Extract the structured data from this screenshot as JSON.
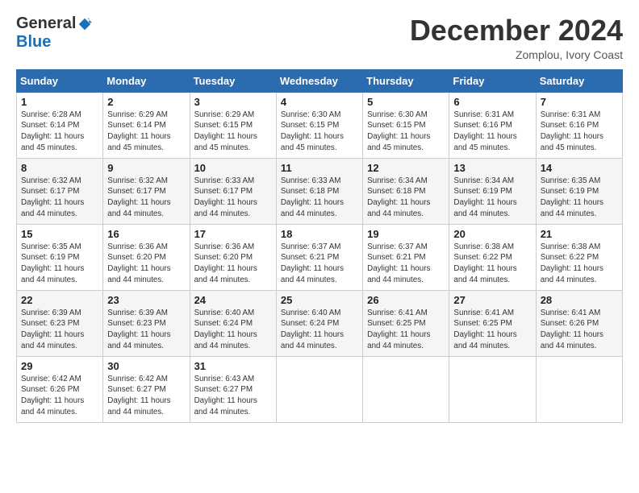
{
  "logo": {
    "general": "General",
    "blue": "Blue"
  },
  "header": {
    "month_title": "December 2024",
    "location": "Zomplou, Ivory Coast"
  },
  "days_of_week": [
    "Sunday",
    "Monday",
    "Tuesday",
    "Wednesday",
    "Thursday",
    "Friday",
    "Saturday"
  ],
  "weeks": [
    [
      {
        "day": "1",
        "sunrise": "6:28 AM",
        "sunset": "6:14 PM",
        "daylight": "11 hours and 45 minutes."
      },
      {
        "day": "2",
        "sunrise": "6:29 AM",
        "sunset": "6:14 PM",
        "daylight": "11 hours and 45 minutes."
      },
      {
        "day": "3",
        "sunrise": "6:29 AM",
        "sunset": "6:15 PM",
        "daylight": "11 hours and 45 minutes."
      },
      {
        "day": "4",
        "sunrise": "6:30 AM",
        "sunset": "6:15 PM",
        "daylight": "11 hours and 45 minutes."
      },
      {
        "day": "5",
        "sunrise": "6:30 AM",
        "sunset": "6:15 PM",
        "daylight": "11 hours and 45 minutes."
      },
      {
        "day": "6",
        "sunrise": "6:31 AM",
        "sunset": "6:16 PM",
        "daylight": "11 hours and 45 minutes."
      },
      {
        "day": "7",
        "sunrise": "6:31 AM",
        "sunset": "6:16 PM",
        "daylight": "11 hours and 45 minutes."
      }
    ],
    [
      {
        "day": "8",
        "sunrise": "6:32 AM",
        "sunset": "6:17 PM",
        "daylight": "11 hours and 44 minutes."
      },
      {
        "day": "9",
        "sunrise": "6:32 AM",
        "sunset": "6:17 PM",
        "daylight": "11 hours and 44 minutes."
      },
      {
        "day": "10",
        "sunrise": "6:33 AM",
        "sunset": "6:17 PM",
        "daylight": "11 hours and 44 minutes."
      },
      {
        "day": "11",
        "sunrise": "6:33 AM",
        "sunset": "6:18 PM",
        "daylight": "11 hours and 44 minutes."
      },
      {
        "day": "12",
        "sunrise": "6:34 AM",
        "sunset": "6:18 PM",
        "daylight": "11 hours and 44 minutes."
      },
      {
        "day": "13",
        "sunrise": "6:34 AM",
        "sunset": "6:19 PM",
        "daylight": "11 hours and 44 minutes."
      },
      {
        "day": "14",
        "sunrise": "6:35 AM",
        "sunset": "6:19 PM",
        "daylight": "11 hours and 44 minutes."
      }
    ],
    [
      {
        "day": "15",
        "sunrise": "6:35 AM",
        "sunset": "6:19 PM",
        "daylight": "11 hours and 44 minutes."
      },
      {
        "day": "16",
        "sunrise": "6:36 AM",
        "sunset": "6:20 PM",
        "daylight": "11 hours and 44 minutes."
      },
      {
        "day": "17",
        "sunrise": "6:36 AM",
        "sunset": "6:20 PM",
        "daylight": "11 hours and 44 minutes."
      },
      {
        "day": "18",
        "sunrise": "6:37 AM",
        "sunset": "6:21 PM",
        "daylight": "11 hours and 44 minutes."
      },
      {
        "day": "19",
        "sunrise": "6:37 AM",
        "sunset": "6:21 PM",
        "daylight": "11 hours and 44 minutes."
      },
      {
        "day": "20",
        "sunrise": "6:38 AM",
        "sunset": "6:22 PM",
        "daylight": "11 hours and 44 minutes."
      },
      {
        "day": "21",
        "sunrise": "6:38 AM",
        "sunset": "6:22 PM",
        "daylight": "11 hours and 44 minutes."
      }
    ],
    [
      {
        "day": "22",
        "sunrise": "6:39 AM",
        "sunset": "6:23 PM",
        "daylight": "11 hours and 44 minutes."
      },
      {
        "day": "23",
        "sunrise": "6:39 AM",
        "sunset": "6:23 PM",
        "daylight": "11 hours and 44 minutes."
      },
      {
        "day": "24",
        "sunrise": "6:40 AM",
        "sunset": "6:24 PM",
        "daylight": "11 hours and 44 minutes."
      },
      {
        "day": "25",
        "sunrise": "6:40 AM",
        "sunset": "6:24 PM",
        "daylight": "11 hours and 44 minutes."
      },
      {
        "day": "26",
        "sunrise": "6:41 AM",
        "sunset": "6:25 PM",
        "daylight": "11 hours and 44 minutes."
      },
      {
        "day": "27",
        "sunrise": "6:41 AM",
        "sunset": "6:25 PM",
        "daylight": "11 hours and 44 minutes."
      },
      {
        "day": "28",
        "sunrise": "6:41 AM",
        "sunset": "6:26 PM",
        "daylight": "11 hours and 44 minutes."
      }
    ],
    [
      {
        "day": "29",
        "sunrise": "6:42 AM",
        "sunset": "6:26 PM",
        "daylight": "11 hours and 44 minutes."
      },
      {
        "day": "30",
        "sunrise": "6:42 AM",
        "sunset": "6:27 PM",
        "daylight": "11 hours and 44 minutes."
      },
      {
        "day": "31",
        "sunrise": "6:43 AM",
        "sunset": "6:27 PM",
        "daylight": "11 hours and 44 minutes."
      },
      null,
      null,
      null,
      null
    ]
  ]
}
